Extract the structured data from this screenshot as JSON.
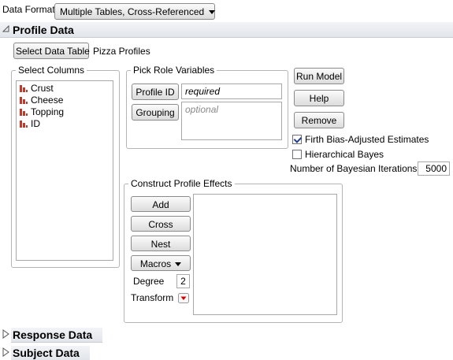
{
  "header": {
    "data_format_label": "Data Format",
    "data_format_value": "Multiple Tables, Cross-Referenced"
  },
  "profile": {
    "title": "Profile Data",
    "select_table_button": "Select Data Table",
    "table_name": "Pizza Profiles",
    "select_columns_legend": "Select Columns",
    "columns": [
      "Crust",
      "Cheese",
      "Topping",
      "ID"
    ],
    "pick_role_legend": "Pick Role Variables",
    "profile_id_button": "Profile ID",
    "profile_id_value": "required",
    "grouping_button": "Grouping",
    "grouping_value": "optional",
    "run_model": "Run Model",
    "help": "Help",
    "remove": "Remove",
    "firth_label": "Firth Bias-Adjusted Estimates",
    "firth_checked": true,
    "hier_label": "Hierarchical Bayes",
    "hier_checked": false,
    "iterations_label": "Number of Bayesian Iterations",
    "iterations_value": "5000",
    "construct_legend": "Construct Profile Effects",
    "add": "Add",
    "cross": "Cross",
    "nest": "Nest",
    "macros": "Macros",
    "degree_label": "Degree",
    "degree_value": "2",
    "transform_label": "Transform"
  },
  "response": {
    "title": "Response Data"
  },
  "subject": {
    "title": "Subject Data"
  },
  "colors": {
    "column_icon": "#c0392b",
    "red_triangle": "#d40000",
    "checkmark": "#1e3f8c"
  }
}
